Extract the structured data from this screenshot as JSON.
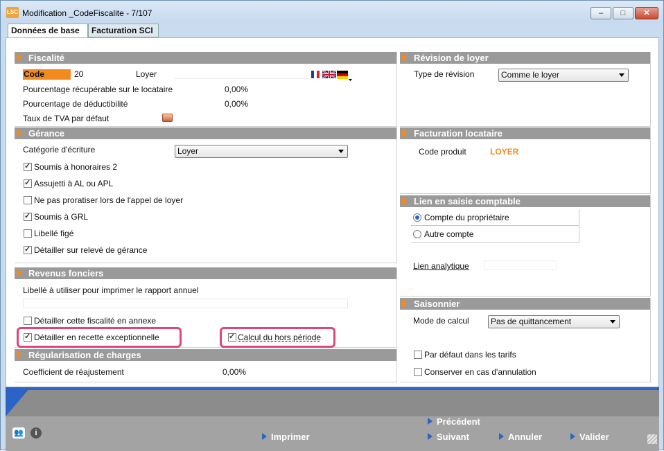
{
  "window": {
    "app_icon": "LSC",
    "title": "Modification _CodeFiscalite - 7/107",
    "controls": [
      "minimize-icon",
      "maximize-icon",
      "close-icon"
    ]
  },
  "tabs": [
    {
      "label": "Données de base",
      "active": true
    },
    {
      "label": "Facturation SCI",
      "active": false
    }
  ],
  "fiscalite": {
    "header": "Fiscalité",
    "code_label": "Code",
    "code_value": "20",
    "libelle_value": "Loyer",
    "pct_recuperable_label": "Pourcentage récupérable sur le locataire",
    "pct_recuperable_value": "0,00%",
    "pct_deductibilite_label": "Pourcentage de déductibilité",
    "pct_deductibilite_value": "0,00%",
    "tva_label": "Taux de TVA par défaut",
    "flags_icon": "flags-icon"
  },
  "gerance": {
    "header": "Gérance",
    "categorie_label": "Catégorie d'écriture",
    "categorie_value": "Loyer",
    "checkboxes": [
      {
        "label": "Soumis à honoraires 2",
        "checked": true
      },
      {
        "label": "Assujetti à AL ou APL",
        "checked": true
      },
      {
        "label": "Ne pas proratiser lors de l'appel de loyer",
        "checked": false
      },
      {
        "label": "Soumis à GRL",
        "checked": true
      },
      {
        "label": "Libellé figé",
        "checked": false
      },
      {
        "label": "Détailler sur relevé de gérance",
        "checked": true
      }
    ]
  },
  "revenus": {
    "header": "Revenus fonciers",
    "libelle_label": "Libellé à utiliser pour imprimer le rapport annuel",
    "libelle_value": "",
    "annexe_label": "Détailler cette fiscalité en annexe",
    "annexe_checked": false,
    "recette_label": "Détailler en recette exceptionnelle",
    "recette_checked": true,
    "hors_periode_label": "Calcul du hors période",
    "hors_periode_checked": true
  },
  "regularisation": {
    "header": "Régularisation de charges",
    "coef_label": "Coefficient de réajustement",
    "coef_value": "0,00%"
  },
  "revision": {
    "header": "Révision de loyer",
    "type_label": "Type de révision",
    "type_value": "Comme le loyer"
  },
  "facturation": {
    "header": "Facturation locataire",
    "code_produit_label": "Code produit",
    "code_produit_value": "LOYER"
  },
  "lien": {
    "header": "Lien en saisie comptable",
    "radio_proprietaire": "Compte du propriétaire",
    "radio_autre": "Autre compte",
    "selected": "proprietaire",
    "lien_analytique_label": "Lien analytique",
    "lien_analytique_value": ""
  },
  "saisonnier": {
    "header": "Saisonnier",
    "mode_label": "Mode de calcul",
    "mode_value": "Pas de quittancement",
    "tarifs_label": "Par défaut dans les tarifs",
    "tarifs_checked": false,
    "annulation_label": "Conserver en cas d'annulation",
    "annulation_checked": false
  },
  "actions": {
    "precedent": "Précédent",
    "suivant": "Suivant",
    "imprimer": "Imprimer",
    "annuler": "Annuler",
    "valider": "Valider"
  },
  "status_icons": [
    "users-icon",
    "info-icon"
  ],
  "colors": {
    "accent_orange": "#f28a1d",
    "highlight_pink": "#e0457a",
    "accent_blue": "#2b63c6",
    "section_header": "#9a9a9a"
  }
}
